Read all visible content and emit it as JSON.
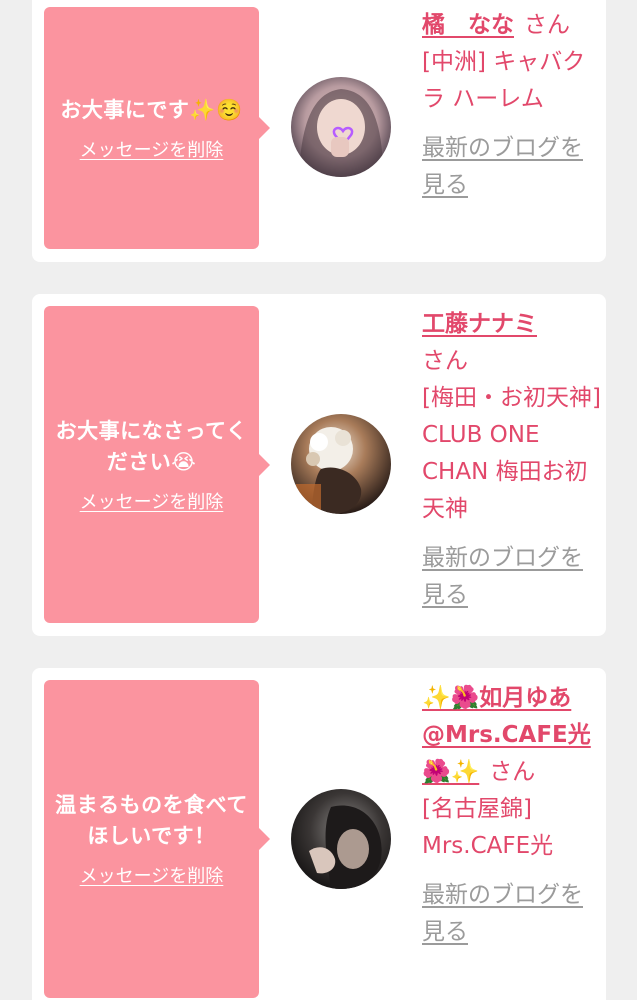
{
  "messages": [
    {
      "text": "お大事にです✨☺️",
      "delete_label": "メッセージを削除",
      "name": "橘　なな",
      "suffix": "さん",
      "shop": "[中洲] キャバクラ ハーレム",
      "blog_label": "最新のブログを見る"
    },
    {
      "text": "お大事になさってください😭",
      "delete_label": "メッセージを削除",
      "name": "工藤ナナミ",
      "suffix": "さん",
      "shop": "[梅田・お初天神] CLUB ONE CHAN 梅田お初天神",
      "blog_label": "最新のブログを見る"
    },
    {
      "text": "温まるものを食べてほしいです！",
      "delete_label": "メッセージを削除",
      "name": "✨🌺如月ゆあ@Mrs.CAFE光🌺✨",
      "suffix": "さん",
      "shop": "[名古屋錦] Mrs.CAFE光",
      "blog_label": "最新のブログを見る"
    }
  ],
  "colors": {
    "bubble": "#fb949f",
    "accent": "#e2486b",
    "muted_link": "#9b9b9b",
    "page_background": "#efefef"
  },
  "icons": [
    "avatar-photo"
  ]
}
